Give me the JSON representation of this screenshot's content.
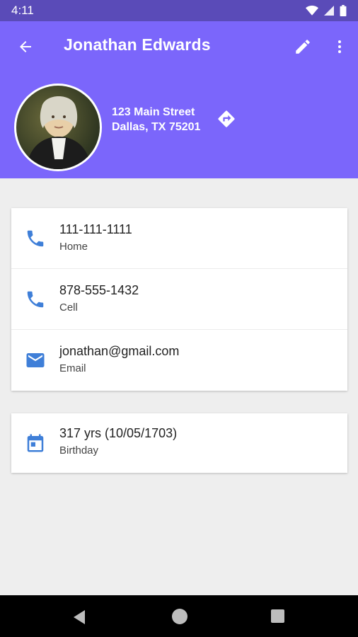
{
  "status_bar": {
    "time": "4:11",
    "icons": [
      "wifi-icon",
      "signal-icon",
      "battery-icon"
    ]
  },
  "app_bar": {
    "title": "Jonathan Edwards",
    "back_icon": "arrow-back-icon",
    "edit_icon": "pencil-icon",
    "more_icon": "more-vert-icon"
  },
  "profile": {
    "address_line1": "123 Main Street",
    "address_line2": "Dallas, TX 75201",
    "directions_icon": "directions-icon"
  },
  "contacts": [
    {
      "value": "111-111-1111",
      "label": "Home",
      "icon": "phone-icon"
    },
    {
      "value": "878-555-1432",
      "label": "Cell",
      "icon": "phone-icon"
    },
    {
      "value": "jonathan@gmail.com",
      "label": "Email",
      "icon": "email-icon"
    }
  ],
  "birthday": {
    "value": "317 yrs (10/05/1703)",
    "label": "Birthday",
    "icon": "calendar-icon"
  },
  "colors": {
    "primary": "#7b66fb",
    "status_bar": "#5a4bb8",
    "icon_blue": "#3f7fd8",
    "background": "#eeeeee"
  },
  "nav_bar": {
    "icons": [
      "nav-back-icon",
      "nav-home-icon",
      "nav-recents-icon"
    ]
  }
}
